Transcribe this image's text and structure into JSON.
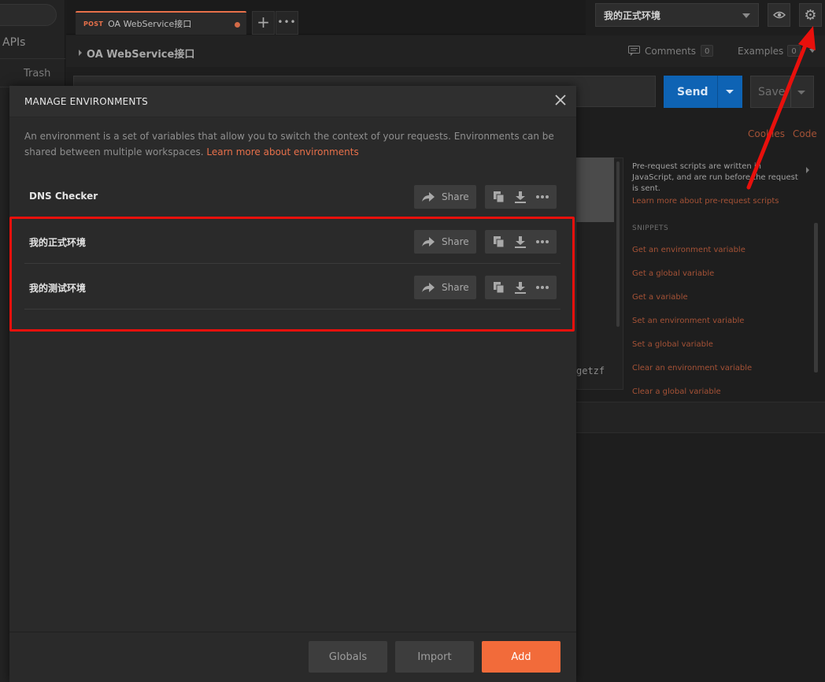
{
  "sidebar": {
    "apis_label": "APIs",
    "trash_label": "Trash"
  },
  "tab": {
    "method": "POST",
    "title": "OA WebService接口",
    "add_label": "+",
    "more_label": "•••"
  },
  "top_right": {
    "environment_selected": "我的正式环境"
  },
  "request": {
    "title": "OA WebService接口",
    "comments_label": "Comments",
    "comments_count": "0",
    "examples_label": "Examples",
    "examples_count": "0",
    "send_label": "Send",
    "save_label": "Save",
    "cookies_label": "Cookies",
    "code_label": "Code"
  },
  "scripts_panel": {
    "description": "Pre-request scripts are written in JavaScript, and are run before the request is sent.",
    "learn_more": "Learn more about pre-request scripts",
    "snippets_heading": "SNIPPETS",
    "snippets": [
      "Get an environment variable",
      "Get a global variable",
      "Get a variable",
      "Set an environment variable",
      "Set a global variable",
      "Clear an environment variable",
      "Clear a global variable"
    ],
    "editor_fragment": "getzf"
  },
  "modal": {
    "title": "MANAGE ENVIRONMENTS",
    "description": "An environment is a set of variables that allow you to switch the context of your requests. Environments can be shared between multiple workspaces.",
    "learn_more": "Learn more about environments",
    "share_label": "Share",
    "environments": [
      {
        "name": "DNS Checker"
      },
      {
        "name": "我的正式环境"
      },
      {
        "name": "我的测试环境"
      }
    ],
    "globals_label": "Globals",
    "import_label": "Import",
    "add_label": "Add"
  },
  "colors": {
    "accent": "#f26b3a",
    "send": "#0e63b4",
    "annotation": "#e8100c"
  }
}
